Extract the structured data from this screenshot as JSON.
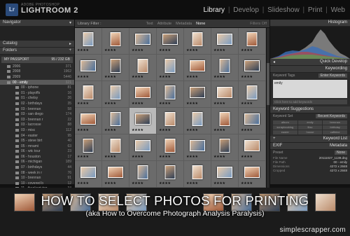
{
  "app": {
    "vendor": "ADOBE PHOTOSHOP",
    "product": "LIGHTROOM 2",
    "badge": "Lr"
  },
  "modules": [
    "Library",
    "Develop",
    "Slideshow",
    "Print",
    "Web"
  ],
  "modules_sep": "|",
  "left_panel": {
    "navigator": "Navigator",
    "catalog": "Catalog",
    "folders": "Folders",
    "volume": {
      "name": "MY PASSPORT",
      "free": "95 / 232 GB"
    },
    "items": [
      {
        "name": "2006",
        "count": "371"
      },
      {
        "name": "2008",
        "count": "1962"
      },
      {
        "name": "2009",
        "count": "5446"
      },
      {
        "name": "00 - emily",
        "count": "321",
        "selected": true
      },
      {
        "name": "00 - iphone",
        "count": "81"
      },
      {
        "name": "01 - playoffs",
        "count": "16"
      },
      {
        "name": "01 - chelsy",
        "count": "26"
      },
      {
        "name": "02 - birthdays",
        "count": "35"
      },
      {
        "name": "03 - brennan",
        "count": "58"
      },
      {
        "name": "03 - san diego",
        "count": "174"
      },
      {
        "name": "03 - brennan r",
        "count": "22"
      },
      {
        "name": "03 - lacrosse",
        "count": "88"
      },
      {
        "name": "03 - misc",
        "count": "112"
      },
      {
        "name": "04 - easter",
        "count": "95"
      },
      {
        "name": "05 - steve birt",
        "count": "40"
      },
      {
        "name": "05 - mnami",
        "count": "63"
      },
      {
        "name": "06 - wtc tour",
        "count": "23"
      },
      {
        "name": "06 - houston",
        "count": "17"
      },
      {
        "name": "06 - michigan",
        "count": "189"
      },
      {
        "name": "07 - birthdays",
        "count": "44"
      },
      {
        "name": "08 - week in r",
        "count": "76"
      },
      {
        "name": "10 - brennan",
        "count": "91"
      },
      {
        "name": "10 - covered b",
        "count": "12"
      },
      {
        "name": "11 - thanksgiving",
        "count": "34"
      },
      {
        "name": "12 - december",
        "count": "202"
      }
    ]
  },
  "filter_bar": {
    "label": "Library Filter :",
    "tabs": [
      "Text",
      "Attribute",
      "Metadata",
      "None"
    ],
    "active": "None",
    "right": "Filters Off"
  },
  "right_panel": {
    "histogram": "Histogram",
    "quick_develop": "Quick Develop",
    "keywording": "Keywording",
    "keyword_tags_label": "Keyword Tags",
    "keyword_tags_value": "Enter Keywords",
    "keyword_text": "emily",
    "keyword_add": "Click here to add keywords",
    "keyword_suggestions": "Keyword Suggestions",
    "keyword_set_label": "Keyword Set",
    "keyword_set_value": "Recent Keywords",
    "chips": [
      "album",
      "emily",
      "brennan",
      "scrapbooking",
      "lilac",
      "birthday",
      "easter",
      "house",
      "caffeine"
    ],
    "keyword_list": "Keyword List",
    "metadata": "Metadata",
    "exif": "EXIF",
    "preset_label": "Preset",
    "preset_value": "None",
    "meta_rows": [
      {
        "k": "File Name",
        "v": "20111027_1139.dng"
      },
      {
        "k": "File Path",
        "v": "00 - emily"
      },
      {
        "k": "Dimensions",
        "v": "4272 x 2848"
      },
      {
        "k": "Cropped",
        "v": "4272 x 2848"
      }
    ]
  },
  "grid": {
    "stars": "★★★★"
  },
  "overlay": {
    "title": "HOW TO SELECT PHOTOS FOR PRINTING",
    "subtitle": "(aka How to Overcome Photograph Analysis Paralysis)",
    "site": "simplescrapper.com"
  }
}
